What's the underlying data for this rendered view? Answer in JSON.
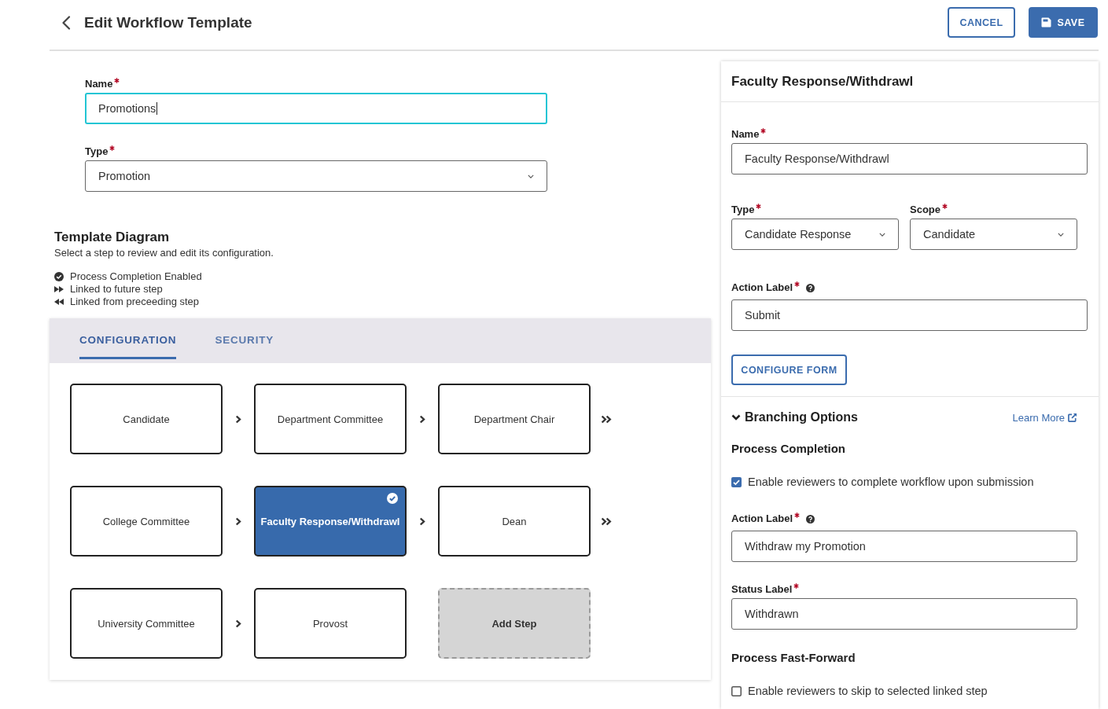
{
  "header": {
    "title": "Edit Workflow Template",
    "buttons": [
      {
        "label": "CANCEL",
        "kind": "outline"
      },
      {
        "label": "SAVE",
        "kind": "primary"
      }
    ]
  },
  "template_fields": [
    {
      "label": "Name",
      "required": true,
      "kind": "text",
      "value": "Promotions",
      "focused": true
    },
    {
      "label": "Type",
      "required": true,
      "kind": "select",
      "value": "Promotion",
      "focused": false
    }
  ],
  "diagram": {
    "title": "Template Diagram",
    "subtitle": "Select a step to review and edit its configuration.",
    "legend": [
      {
        "kind": "completion",
        "text": "Process Completion Enabled"
      },
      {
        "kind": "linked_to",
        "text": "Linked to future step"
      },
      {
        "kind": "linked_from",
        "text": "Linked from preceeding step"
      }
    ],
    "tabs": [
      {
        "label": "CONFIGURATION",
        "selected": true
      },
      {
        "label": "SECURITY",
        "selected": false
      }
    ],
    "steps": [
      {
        "name": "Candidate",
        "selected": false,
        "completion": false,
        "connector": {
          "kind": "chevron"
        }
      },
      {
        "name": "Department Committee",
        "selected": false,
        "completion": false,
        "connector": {
          "kind": "chevron"
        }
      },
      {
        "name": "Department Chair",
        "selected": false,
        "completion": false,
        "connector": {
          "kind": "double_chevron"
        }
      },
      {
        "name": "College Committee",
        "selected": false,
        "completion": false,
        "connector": {
          "kind": "chevron"
        }
      },
      {
        "name": "Faculty Response/Withdrawl",
        "selected": true,
        "completion": true,
        "connector": {
          "kind": "chevron"
        }
      },
      {
        "name": "Dean",
        "selected": false,
        "completion": false,
        "connector": {
          "kind": "double_chevron"
        }
      },
      {
        "name": "University Committee",
        "selected": false,
        "completion": false,
        "connector": {
          "kind": "chevron"
        }
      },
      {
        "name": "Provost",
        "selected": false,
        "completion": false
      }
    ],
    "add_step": "Add Step"
  },
  "step_panel": {
    "title": "Faculty Response/Withdrawl",
    "name": {
      "label": "Name",
      "required": true,
      "value": "Faculty Response/Withdrawl"
    },
    "type": {
      "label": "Type",
      "required": true,
      "value": "Candidate Response"
    },
    "scope": {
      "label": "Scope",
      "required": true,
      "value": "Candidate"
    },
    "action_label": {
      "label": "Action Label",
      "required": true,
      "help": true,
      "value": "Submit"
    },
    "configure_button": "CONFIGURE FORM",
    "branching": {
      "title": "Branching Options",
      "expanded": true,
      "link": "Learn More",
      "sections": [
        {
          "title": "Process Completion",
          "checkbox": {
            "label": "Enable reviewers to complete workflow upon submission",
            "checked": true
          },
          "fields": [
            {
              "label": "Action Label",
              "required": true,
              "help": true,
              "value": "Withdraw my Promotion"
            },
            {
              "label": "Status Label",
              "required": true,
              "value": "Withdrawn"
            }
          ]
        },
        {
          "title": "Process Fast-Forward",
          "checkbox": {
            "label": "Enable reviewers to skip to selected linked step",
            "checked": false
          }
        }
      ]
    }
  }
}
